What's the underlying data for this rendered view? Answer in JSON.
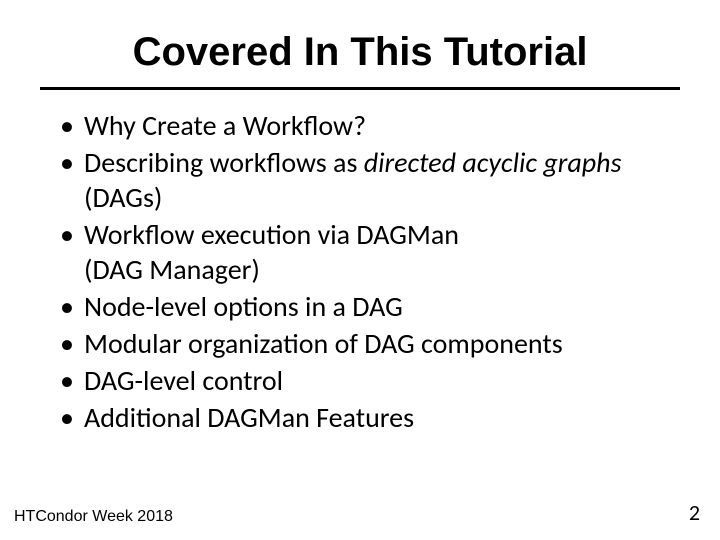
{
  "title": "Covered In This Tutorial",
  "bullets": {
    "b0": "Why Create a Workflow?",
    "b1_pre": "Describing workflows as ",
    "b1_italic": "directed acyclic graphs",
    "b1_post": " (DAGs)",
    "b2_line1": "Workflow execution via DAGMan",
    "b2_line2": " (DAG Manager)",
    "b3": "Node-level options in a DAG",
    "b4": "Modular organization of DAG components",
    "b5": "DAG-level control",
    "b6": "Additional DAGMan Features"
  },
  "footer": {
    "left": "HTCondor Week 2018",
    "right": "2"
  }
}
